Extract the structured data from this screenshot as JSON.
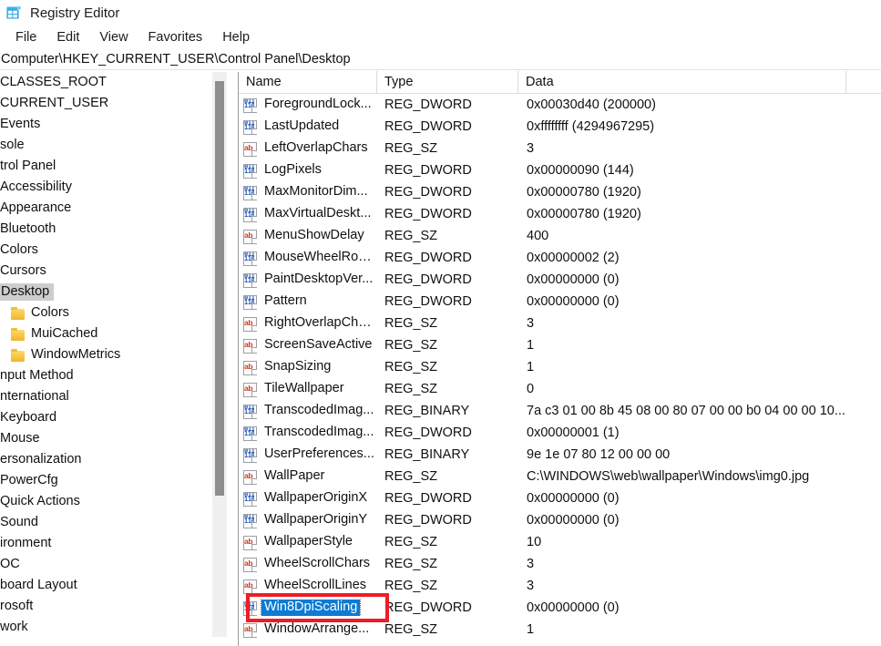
{
  "window": {
    "title": "Registry Editor",
    "icon": "registry-editor-icon"
  },
  "menubar": {
    "items": [
      {
        "label": "File"
      },
      {
        "label": "Edit"
      },
      {
        "label": "View"
      },
      {
        "label": "Favorites"
      },
      {
        "label": "Help"
      }
    ]
  },
  "address": {
    "path": "Computer\\HKEY_CURRENT_USER\\Control Panel\\Desktop"
  },
  "tree": {
    "scrolled_horizontally": true,
    "items": [
      {
        "label": "CLASSES_ROOT",
        "indent": 0,
        "folder": false,
        "selected": false
      },
      {
        "label": "CURRENT_USER",
        "indent": 0,
        "folder": false,
        "selected": false
      },
      {
        "label": "Events",
        "indent": 0,
        "folder": false,
        "selected": false,
        "clipped_prefix": "p"
      },
      {
        "label": "sole",
        "indent": 0,
        "folder": false,
        "selected": false
      },
      {
        "label": "trol Panel",
        "indent": 0,
        "folder": false,
        "selected": false
      },
      {
        "label": "Accessibility",
        "indent": 0,
        "folder": false,
        "selected": false
      },
      {
        "label": "Appearance",
        "indent": 0,
        "folder": false,
        "selected": false
      },
      {
        "label": "Bluetooth",
        "indent": 0,
        "folder": false,
        "selected": false
      },
      {
        "label": "Colors",
        "indent": 0,
        "folder": false,
        "selected": false
      },
      {
        "label": "Cursors",
        "indent": 0,
        "folder": false,
        "selected": false
      },
      {
        "label": "Desktop",
        "indent": 0,
        "folder": false,
        "selected": true
      },
      {
        "label": "Colors",
        "indent": 1,
        "folder": true,
        "selected": false
      },
      {
        "label": "MuiCached",
        "indent": 1,
        "folder": true,
        "selected": false
      },
      {
        "label": "WindowMetrics",
        "indent": 1,
        "folder": true,
        "selected": false
      },
      {
        "label": "nput Method",
        "indent": 0,
        "folder": false,
        "selected": false
      },
      {
        "label": "nternational",
        "indent": 0,
        "folder": false,
        "selected": false
      },
      {
        "label": "Keyboard",
        "indent": 0,
        "folder": false,
        "selected": false
      },
      {
        "label": "Mouse",
        "indent": 0,
        "folder": false,
        "selected": false
      },
      {
        "label": "ersonalization",
        "indent": 0,
        "folder": false,
        "selected": false
      },
      {
        "label": "PowerCfg",
        "indent": 0,
        "folder": false,
        "selected": false
      },
      {
        "label": "Quick Actions",
        "indent": 0,
        "folder": false,
        "selected": false
      },
      {
        "label": "Sound",
        "indent": 0,
        "folder": false,
        "selected": false
      },
      {
        "label": "ironment",
        "indent": 0,
        "folder": false,
        "selected": false
      },
      {
        "label": "OC",
        "indent": 0,
        "folder": false,
        "selected": false
      },
      {
        "label": "board Layout",
        "indent": 0,
        "folder": false,
        "selected": false
      },
      {
        "label": "rosoft",
        "indent": 0,
        "folder": false,
        "selected": false
      },
      {
        "label": "work",
        "indent": 0,
        "folder": false,
        "selected": false
      }
    ]
  },
  "list": {
    "columns": [
      {
        "label": "Name"
      },
      {
        "label": "Type"
      },
      {
        "label": "Data"
      }
    ],
    "rows": [
      {
        "name": "ForegroundLock...",
        "type": "REG_DWORD",
        "data": "0x00030d40 (200000)",
        "icon": "dword-value-icon",
        "selected": false
      },
      {
        "name": "LastUpdated",
        "type": "REG_DWORD",
        "data": "0xffffffff (4294967295)",
        "icon": "dword-value-icon",
        "selected": false
      },
      {
        "name": "LeftOverlapChars",
        "type": "REG_SZ",
        "data": "3",
        "icon": "string-value-icon",
        "selected": false
      },
      {
        "name": "LogPixels",
        "type": "REG_DWORD",
        "data": "0x00000090 (144)",
        "icon": "dword-value-icon",
        "selected": false
      },
      {
        "name": "MaxMonitorDim...",
        "type": "REG_DWORD",
        "data": "0x00000780 (1920)",
        "icon": "dword-value-icon",
        "selected": false
      },
      {
        "name": "MaxVirtualDeskt...",
        "type": "REG_DWORD",
        "data": "0x00000780 (1920)",
        "icon": "dword-value-icon",
        "selected": false
      },
      {
        "name": "MenuShowDelay",
        "type": "REG_SZ",
        "data": "400",
        "icon": "string-value-icon",
        "selected": false
      },
      {
        "name": "MouseWheelRou...",
        "type": "REG_DWORD",
        "data": "0x00000002 (2)",
        "icon": "dword-value-icon",
        "selected": false
      },
      {
        "name": "PaintDesktopVer...",
        "type": "REG_DWORD",
        "data": "0x00000000 (0)",
        "icon": "dword-value-icon",
        "selected": false
      },
      {
        "name": "Pattern",
        "type": "REG_DWORD",
        "data": "0x00000000 (0)",
        "icon": "dword-value-icon",
        "selected": false
      },
      {
        "name": "RightOverlapCha...",
        "type": "REG_SZ",
        "data": "3",
        "icon": "string-value-icon",
        "selected": false
      },
      {
        "name": "ScreenSaveActive",
        "type": "REG_SZ",
        "data": "1",
        "icon": "string-value-icon",
        "selected": false
      },
      {
        "name": "SnapSizing",
        "type": "REG_SZ",
        "data": "1",
        "icon": "string-value-icon",
        "selected": false
      },
      {
        "name": "TileWallpaper",
        "type": "REG_SZ",
        "data": "0",
        "icon": "string-value-icon",
        "selected": false
      },
      {
        "name": "TranscodedImag...",
        "type": "REG_BINARY",
        "data": "7a c3 01 00 8b 45 08 00 80 07 00 00 b0 04 00 00 10...",
        "icon": "dword-value-icon",
        "selected": false
      },
      {
        "name": "TranscodedImag...",
        "type": "REG_DWORD",
        "data": "0x00000001 (1)",
        "icon": "dword-value-icon",
        "selected": false
      },
      {
        "name": "UserPreferences...",
        "type": "REG_BINARY",
        "data": "9e 1e 07 80 12 00 00 00",
        "icon": "dword-value-icon",
        "selected": false
      },
      {
        "name": "WallPaper",
        "type": "REG_SZ",
        "data": "C:\\WINDOWS\\web\\wallpaper\\Windows\\img0.jpg",
        "icon": "string-value-icon",
        "selected": false
      },
      {
        "name": "WallpaperOriginX",
        "type": "REG_DWORD",
        "data": "0x00000000 (0)",
        "icon": "dword-value-icon",
        "selected": false
      },
      {
        "name": "WallpaperOriginY",
        "type": "REG_DWORD",
        "data": "0x00000000 (0)",
        "icon": "dword-value-icon",
        "selected": false
      },
      {
        "name": "WallpaperStyle",
        "type": "REG_SZ",
        "data": "10",
        "icon": "string-value-icon",
        "selected": false
      },
      {
        "name": "WheelScrollChars",
        "type": "REG_SZ",
        "data": "3",
        "icon": "string-value-icon",
        "selected": false
      },
      {
        "name": "WheelScrollLines",
        "type": "REG_SZ",
        "data": "3",
        "icon": "string-value-icon",
        "selected": false
      },
      {
        "name": "Win8DpiScaling",
        "type": "REG_DWORD",
        "data": "0x00000000 (0)",
        "icon": "dword-value-icon",
        "selected": true
      },
      {
        "name": "WindowArrange...",
        "type": "REG_SZ",
        "data": "1",
        "icon": "string-value-icon",
        "selected": false
      }
    ]
  },
  "annotation": {
    "target_row_name": "Win8DpiScaling",
    "color": "#ee1c25"
  },
  "colors": {
    "selection_blue": "#0b7bd4",
    "tree_selection_gray": "#cdcdcd",
    "annotation_red": "#ee1c25",
    "window_bg": "#ffffff",
    "pane_bg": "#f0f0f0"
  }
}
